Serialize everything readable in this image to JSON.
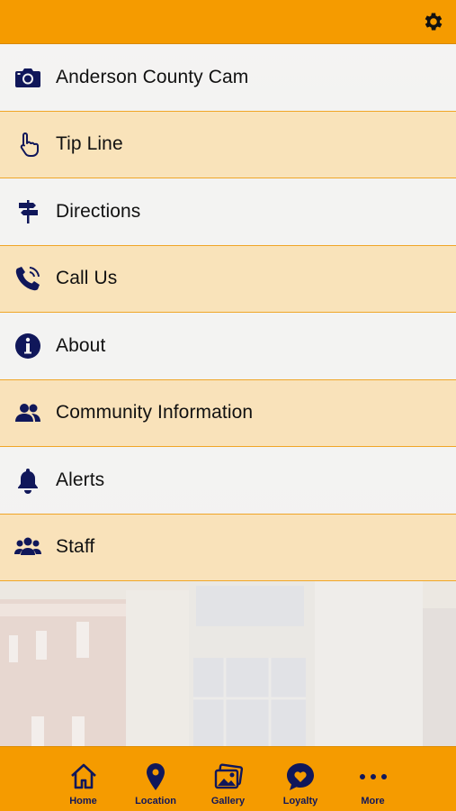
{
  "header": {
    "settings_icon": "gear-icon"
  },
  "menu": {
    "items": [
      {
        "label": "Anderson County Cam",
        "icon": "camera-icon"
      },
      {
        "label": "Tip Line",
        "icon": "pointing-hand-icon"
      },
      {
        "label": "Directions",
        "icon": "signpost-icon"
      },
      {
        "label": "Call Us",
        "icon": "phone-icon"
      },
      {
        "label": "About",
        "icon": "info-icon"
      },
      {
        "label": "Community Information",
        "icon": "users-icon"
      },
      {
        "label": "Alerts",
        "icon": "bell-icon"
      },
      {
        "label": "Staff",
        "icon": "group-icon"
      }
    ]
  },
  "tabbar": {
    "tabs": [
      {
        "label": "Home",
        "icon": "home-icon"
      },
      {
        "label": "Location",
        "icon": "map-pin-icon"
      },
      {
        "label": "Gallery",
        "icon": "image-icon"
      },
      {
        "label": "Loyalty",
        "icon": "heart-chat-icon"
      },
      {
        "label": "More",
        "icon": "ellipsis-icon"
      }
    ]
  },
  "colors": {
    "accent": "#f59b00",
    "icon": "#10175a",
    "row_light": "#f3f3f3",
    "row_tint": "#fae2b6"
  }
}
